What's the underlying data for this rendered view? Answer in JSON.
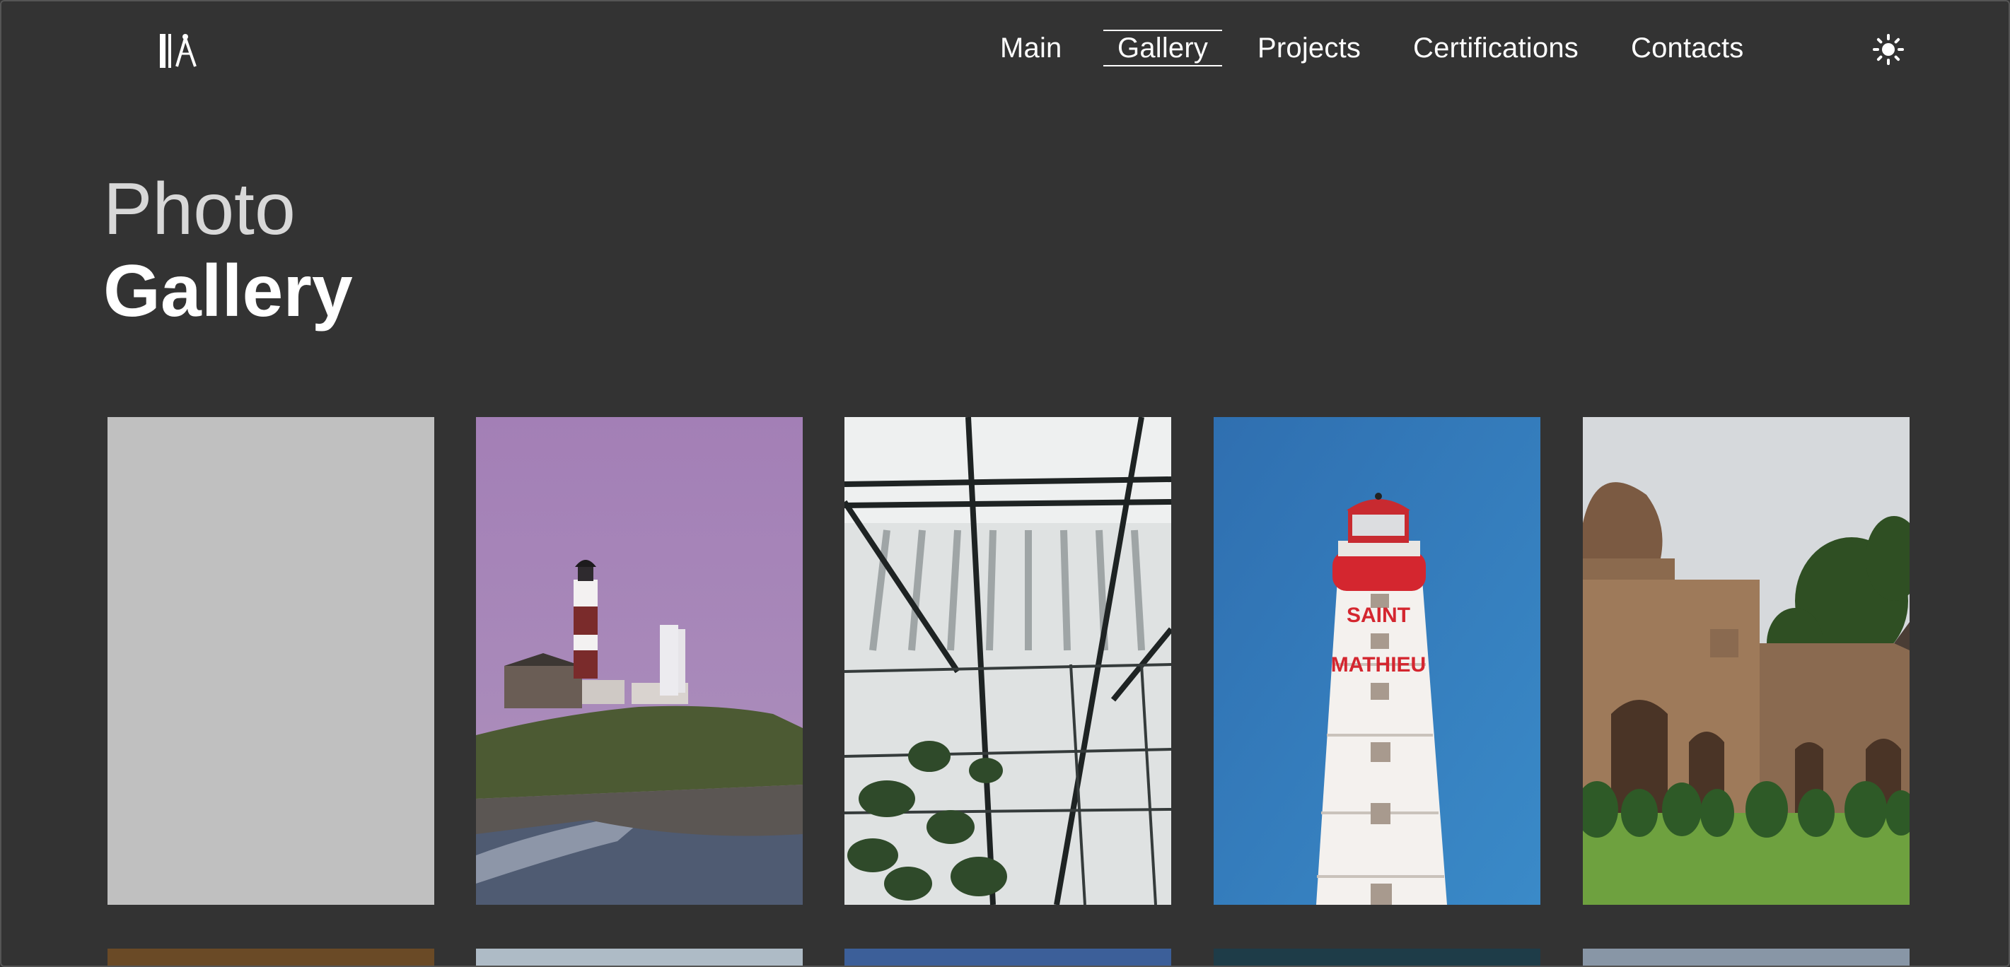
{
  "nav": {
    "items": [
      {
        "label": "Main",
        "active": false
      },
      {
        "label": "Gallery",
        "active": true
      },
      {
        "label": "Projects",
        "active": false
      },
      {
        "label": "Certifications",
        "active": false
      },
      {
        "label": "Contacts",
        "active": false
      }
    ]
  },
  "icons": {
    "logo": "drafting-tools-logo-icon",
    "theme": "sun-icon"
  },
  "page": {
    "title_light": "Photo",
    "title_bold": "Gallery"
  },
  "colors": {
    "background": "#333333",
    "text": "#ffffff",
    "title_light": "#d8d8d8",
    "placeholder_tile": "#c0c0c0"
  },
  "gallery": {
    "rows_visible": 2,
    "columns": 5,
    "photos_row1": [
      "placeholder",
      "lighthouse-at-dusk",
      "greenhouse-glass-roof",
      "saint-mathieu-lighthouse",
      "mughal-tomb"
    ],
    "lighthouse_sign": [
      "SAINT",
      "MATHIEU"
    ]
  }
}
